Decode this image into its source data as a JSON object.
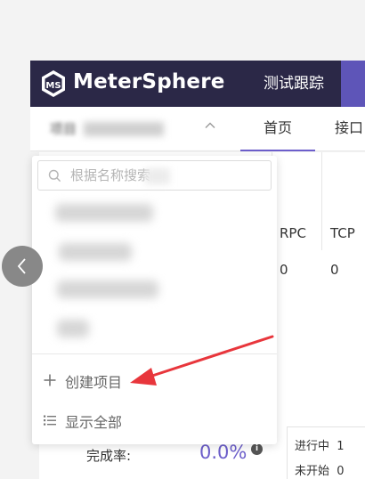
{
  "header": {
    "brand": "MeterSphere",
    "tab": "测试跟踪"
  },
  "subnav": {
    "project_label": "项目",
    "home": "首页",
    "next": "接口"
  },
  "dropdown": {
    "search_placeholder": "根据名称搜索",
    "create_label": "创建项目",
    "show_all_label": "显示全部"
  },
  "background": {
    "protocols": [
      "RPC",
      "TCP"
    ],
    "protocol_values": [
      "0",
      "0"
    ],
    "completion_label": "完成率:",
    "completion_value": "0.0%",
    "info_icon_glyph": "i",
    "status_rows": [
      {
        "label": "进行中",
        "value": "1"
      },
      {
        "label": "未开始",
        "value": "0"
      }
    ]
  },
  "colors": {
    "header_bg": "#2b2847",
    "accent": "#6c5ecb",
    "arrow": "#e8363c"
  },
  "icons": {
    "logo": "metersphere-logo-icon",
    "search": "search-icon",
    "create": "plus-icon",
    "show_all": "list-icon",
    "back": "chevron-left-icon",
    "caret": "chevron-up-icon"
  }
}
